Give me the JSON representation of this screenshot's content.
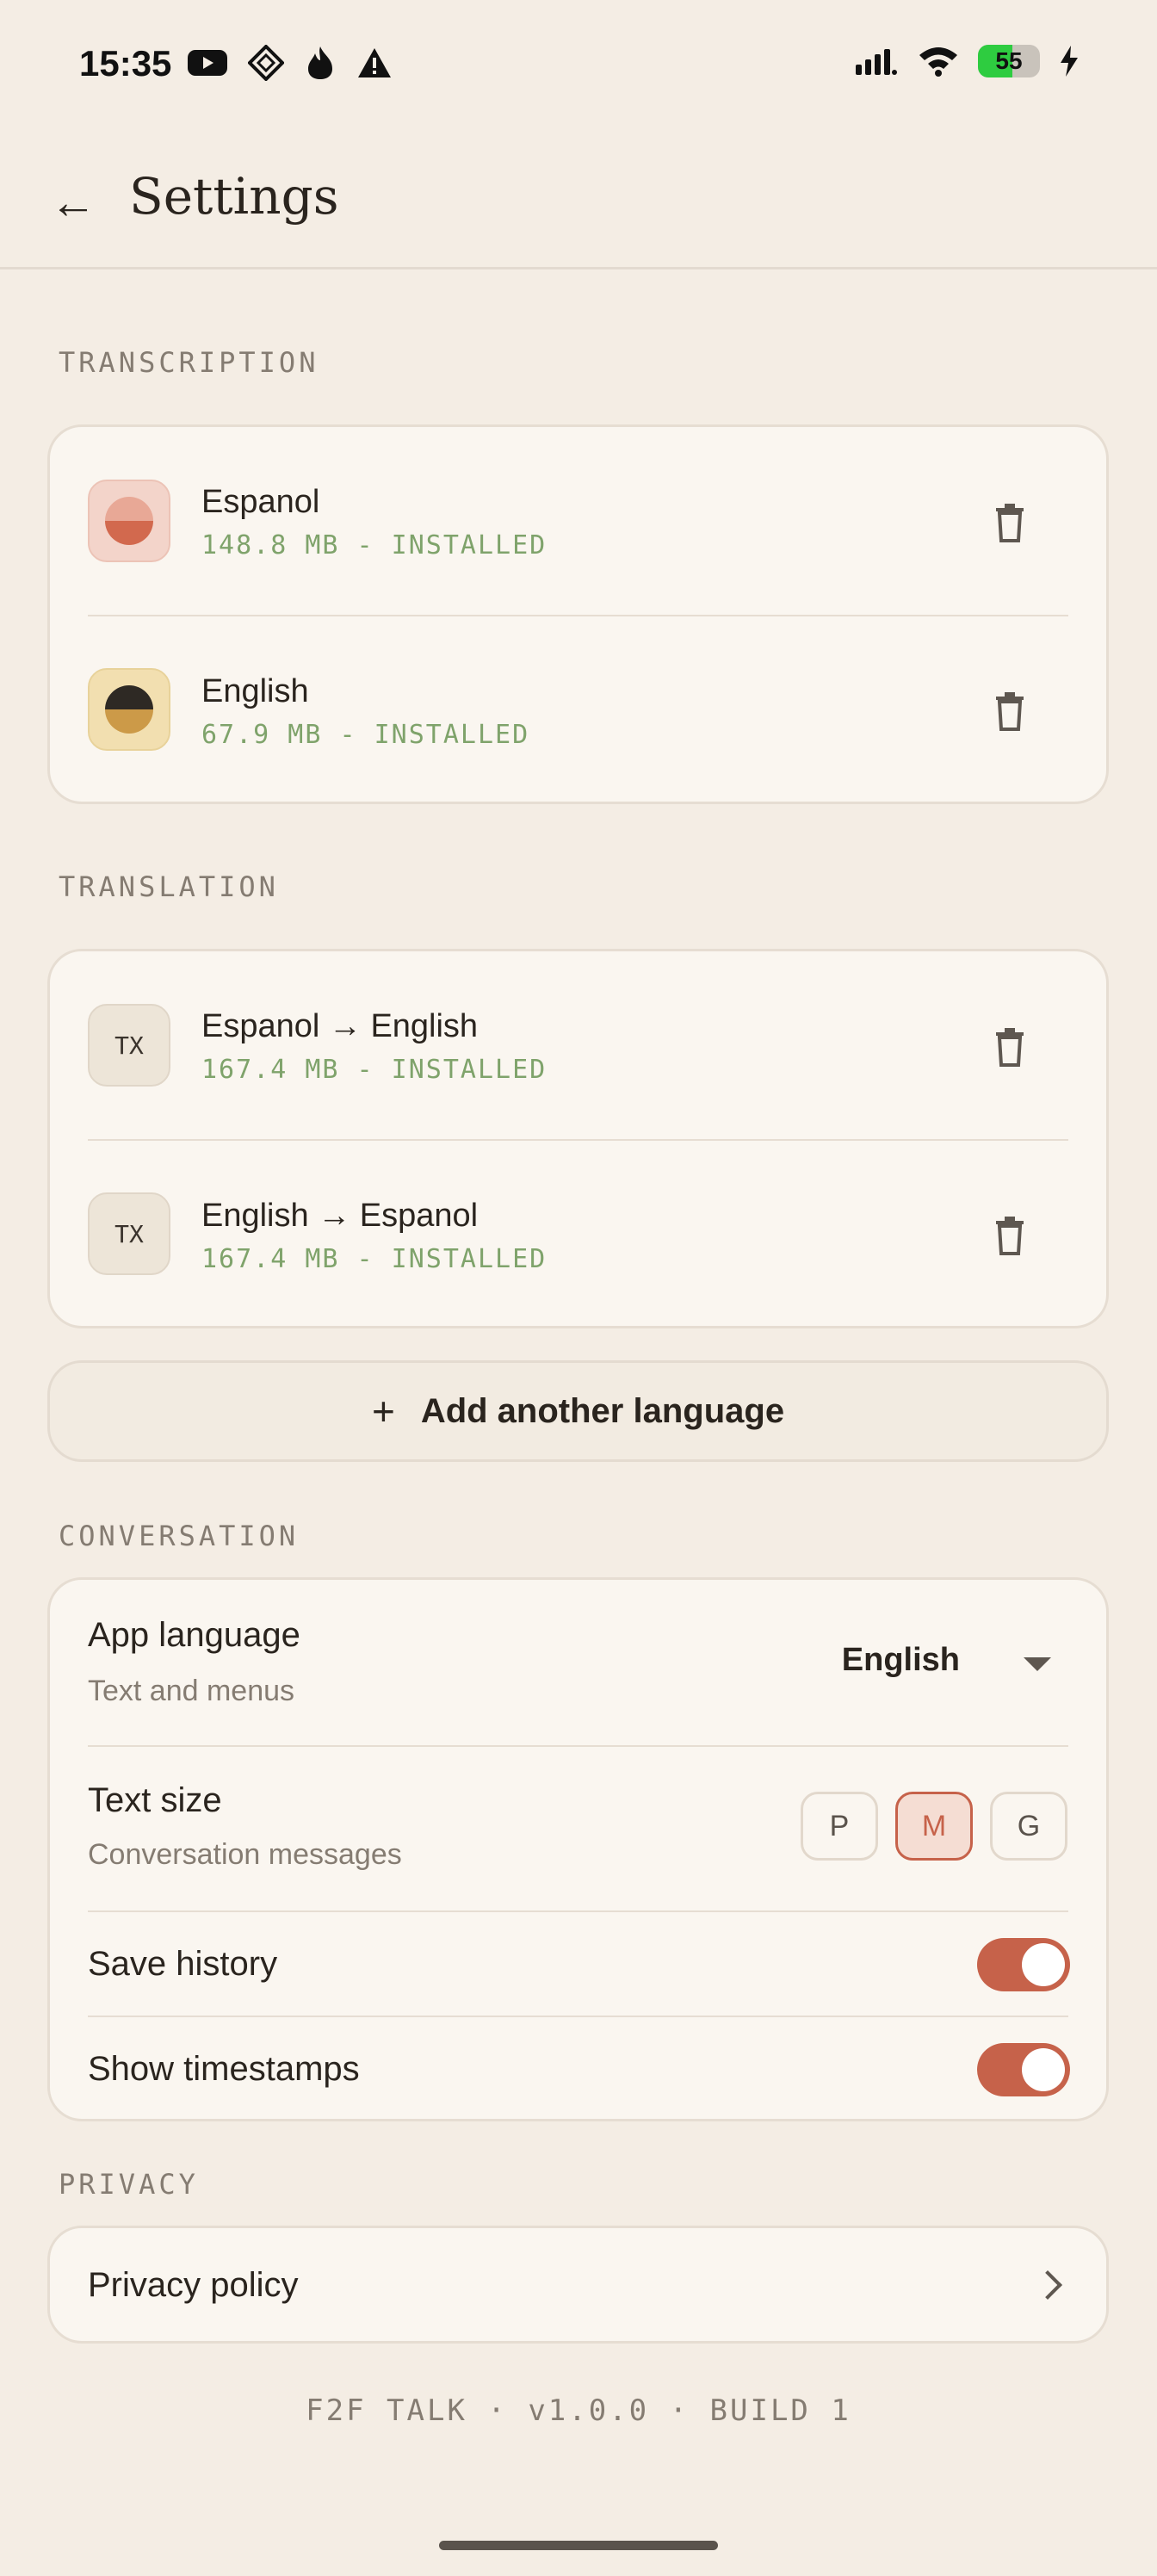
{
  "status_bar": {
    "time": "15:35",
    "left_icons": [
      "youtube-icon",
      "diamond-app-icon",
      "flame-icon",
      "warning-icon"
    ],
    "right_icons": [
      "signal-icon",
      "wifi-icon",
      "battery-icon",
      "charging-icon"
    ],
    "battery_level": "55",
    "battery_fraction": 0.55
  },
  "header": {
    "back_symbol": "←",
    "title": "Settings"
  },
  "transcription": {
    "label": "TRANSCRIPTION",
    "items": [
      {
        "name": "Espanol",
        "meta": "148.8 MB - INSTALLED"
      },
      {
        "name": "English",
        "meta": "67.9 MB - INSTALLED"
      }
    ]
  },
  "translation": {
    "label": "TRANSLATION",
    "items": [
      {
        "badge": "TX",
        "name": "Espanol → English",
        "meta": "167.4 MB - INSTALLED"
      },
      {
        "badge": "TX",
        "name": "English → Espanol",
        "meta": "167.4 MB - INSTALLED"
      }
    ]
  },
  "add_language": {
    "icon": "+",
    "label": "Add another language"
  },
  "conversation": {
    "label": "CONVERSATION",
    "app_language": {
      "title": "App language",
      "subtitle": "Text and menus",
      "value": "English"
    },
    "text_size": {
      "title": "Text size",
      "subtitle": "Conversation messages",
      "options": [
        "P",
        "M",
        "G"
      ],
      "selected": "M"
    },
    "save_history": {
      "title": "Save history",
      "enabled": true
    },
    "show_timestamps": {
      "title": "Show timestamps",
      "enabled": true
    }
  },
  "privacy": {
    "label": "PRIVACY",
    "policy": {
      "title": "Privacy policy"
    }
  },
  "footer": {
    "version_text": "F2F TALK · v1.0.0 · BUILD 1"
  },
  "colors": {
    "accent": "#C6624A",
    "background": "#F4EDE4",
    "card": "#FAF6F0",
    "installed_text": "#7FA36B",
    "muted_text": "#857C72"
  }
}
